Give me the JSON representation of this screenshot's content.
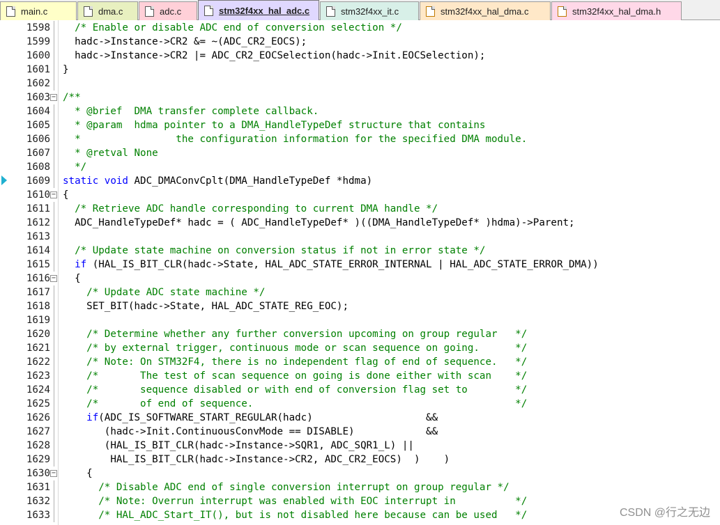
{
  "tabs": [
    {
      "label": "main.c",
      "color": "#ffffc8",
      "icon": "c-file-icon"
    },
    {
      "label": "dma.c",
      "color": "#e8f0c0",
      "icon": "c-file-icon"
    },
    {
      "label": "adc.c",
      "color": "#ffd0d8",
      "icon": "c-file-icon"
    },
    {
      "label": "stm32f4xx_hal_adc.c",
      "color": "#e0d8ff",
      "icon": "c-file-icon",
      "active": true
    },
    {
      "label": "stm32f4xx_it.c",
      "color": "#d8f0e8",
      "icon": "c-file-icon"
    },
    {
      "label": "stm32f4xx_hal_dma.c",
      "color": "#ffe8c8",
      "icon": "h-file-icon"
    },
    {
      "label": "stm32f4xx_hal_dma.h",
      "color": "#ffd8e8",
      "icon": "h-file-icon"
    }
  ],
  "editor": {
    "current_line": "1609",
    "lines": [
      {
        "n": "1598",
        "fold": "",
        "t": "  /* Enable or disable ADC end of conversion selection */",
        "s": "c"
      },
      {
        "n": "1599",
        "fold": "",
        "t": "  hadc->Instance->CR2 &= ~(ADC_CR2_EOCS);",
        "s": ""
      },
      {
        "n": "1600",
        "fold": "",
        "t": "  hadc->Instance->CR2 |= ADC_CR2_EOCSelection(hadc->Init.EOCSelection);",
        "s": ""
      },
      {
        "n": "1601",
        "fold": "",
        "t": "}",
        "s": ""
      },
      {
        "n": "1602",
        "fold": "",
        "t": "",
        "s": ""
      },
      {
        "n": "1603",
        "fold": "-",
        "t": "/**",
        "s": "c"
      },
      {
        "n": "1604",
        "fold": "",
        "t": "  * @brief  DMA transfer complete callback.",
        "s": "c"
      },
      {
        "n": "1605",
        "fold": "",
        "t": "  * @param  hdma pointer to a DMA_HandleTypeDef structure that contains",
        "s": "c"
      },
      {
        "n": "1606",
        "fold": "",
        "t": "  *                the configuration information for the specified DMA module.",
        "s": "c"
      },
      {
        "n": "1607",
        "fold": "",
        "t": "  * @retval None",
        "s": "c"
      },
      {
        "n": "1608",
        "fold": "",
        "t": "  */",
        "s": "c"
      },
      {
        "n": "1609",
        "fold": "",
        "t": "static void ADC_DMAConvCplt(DMA_HandleTypeDef *hdma)",
        "s": "kw"
      },
      {
        "n": "1610",
        "fold": "-",
        "t": "{",
        "s": ""
      },
      {
        "n": "1611",
        "fold": "",
        "t": "  /* Retrieve ADC handle corresponding to current DMA handle */",
        "s": "c"
      },
      {
        "n": "1612",
        "fold": "",
        "t": "  ADC_HandleTypeDef* hadc = ( ADC_HandleTypeDef* )((DMA_HandleTypeDef* )hdma)->Parent;",
        "s": ""
      },
      {
        "n": "1613",
        "fold": "",
        "t": "",
        "s": ""
      },
      {
        "n": "1614",
        "fold": "",
        "t": "  /* Update state machine on conversion status if not in error state */",
        "s": "c"
      },
      {
        "n": "1615",
        "fold": "",
        "t": "  if (HAL_IS_BIT_CLR(hadc->State, HAL_ADC_STATE_ERROR_INTERNAL | HAL_ADC_STATE_ERROR_DMA))",
        "s": "if"
      },
      {
        "n": "1616",
        "fold": "-",
        "t": "  {",
        "s": ""
      },
      {
        "n": "1617",
        "fold": "",
        "t": "    /* Update ADC state machine */",
        "s": "c"
      },
      {
        "n": "1618",
        "fold": "",
        "t": "    SET_BIT(hadc->State, HAL_ADC_STATE_REG_EOC);",
        "s": ""
      },
      {
        "n": "1619",
        "fold": "",
        "t": "",
        "s": ""
      },
      {
        "n": "1620",
        "fold": "",
        "t": "    /* Determine whether any further conversion upcoming on group regular   */",
        "s": "c"
      },
      {
        "n": "1621",
        "fold": "",
        "t": "    /* by external trigger, continuous mode or scan sequence on going.      */",
        "s": "c"
      },
      {
        "n": "1622",
        "fold": "",
        "t": "    /* Note: On STM32F4, there is no independent flag of end of sequence.   */",
        "s": "c"
      },
      {
        "n": "1623",
        "fold": "",
        "t": "    /*       The test of scan sequence on going is done either with scan    */",
        "s": "c"
      },
      {
        "n": "1624",
        "fold": "",
        "t": "    /*       sequence disabled or with end of conversion flag set to        */",
        "s": "c"
      },
      {
        "n": "1625",
        "fold": "",
        "t": "    /*       of end of sequence.                                            */",
        "s": "c"
      },
      {
        "n": "1626",
        "fold": "",
        "t": "    if(ADC_IS_SOFTWARE_START_REGULAR(hadc)                   &&",
        "s": "if"
      },
      {
        "n": "1627",
        "fold": "",
        "t": "       (hadc->Init.ContinuousConvMode == DISABLE)            &&",
        "s": ""
      },
      {
        "n": "1628",
        "fold": "",
        "t": "       (HAL_IS_BIT_CLR(hadc->Instance->SQR1, ADC_SQR1_L) ||",
        "s": ""
      },
      {
        "n": "1629",
        "fold": "",
        "t": "        HAL_IS_BIT_CLR(hadc->Instance->CR2, ADC_CR2_EOCS)  )    )",
        "s": ""
      },
      {
        "n": "1630",
        "fold": "-",
        "t": "    {",
        "s": ""
      },
      {
        "n": "1631",
        "fold": "",
        "t": "      /* Disable ADC end of single conversion interrupt on group regular */",
        "s": "c"
      },
      {
        "n": "1632",
        "fold": "",
        "t": "      /* Note: Overrun interrupt was enabled with EOC interrupt in          */",
        "s": "c"
      },
      {
        "n": "1633",
        "fold": "",
        "t": "      /* HAL_ADC_Start_IT(), but is not disabled here because can be used   */",
        "s": "c"
      }
    ]
  },
  "watermark": "CSDN @行之无边"
}
